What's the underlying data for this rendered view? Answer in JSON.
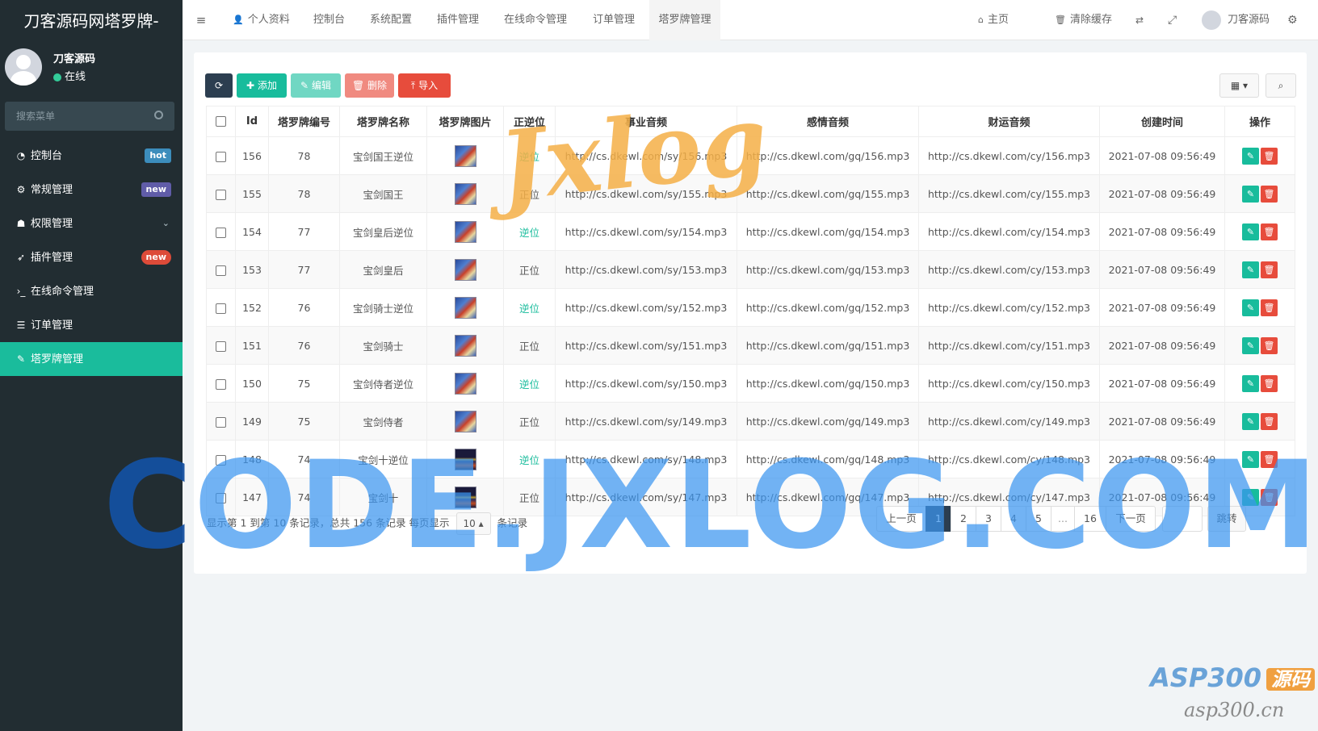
{
  "app": {
    "title": "刀客源码网塔罗牌-"
  },
  "user": {
    "name": "刀客源码",
    "status": "在线"
  },
  "search": {
    "placeholder": "搜索菜单"
  },
  "sidebar": {
    "items": [
      {
        "label": "控制台",
        "icon": "dashboard-icon",
        "badge": "hot"
      },
      {
        "label": "常规管理",
        "icon": "cogs-icon",
        "badge": "new"
      },
      {
        "label": "权限管理",
        "icon": "group-icon",
        "chevron": "chevron-down-icon"
      },
      {
        "label": "插件管理",
        "icon": "rocket-icon",
        "badge": "new"
      },
      {
        "label": "在线命令管理",
        "icon": "terminal-icon"
      },
      {
        "label": "订单管理",
        "icon": "list-icon"
      },
      {
        "label": "塔罗牌管理",
        "icon": "paint-icon",
        "active": true
      }
    ]
  },
  "topnav": {
    "tabs": [
      "个人资料",
      "控制台",
      "系统配置",
      "插件管理",
      "在线命令管理",
      "订单管理",
      "塔罗牌管理"
    ],
    "home": "主页",
    "clear_cache": "清除缓存",
    "username": "刀客源码"
  },
  "toolbar": {
    "add": "添加",
    "edit": "编辑",
    "delete": "删除",
    "import": "导入"
  },
  "table": {
    "headers": [
      "Id",
      "塔罗牌编号",
      "塔罗牌名称",
      "塔罗牌图片",
      "正逆位",
      "事业音频",
      "感情音频",
      "财运音频",
      "创建时间",
      "操作"
    ],
    "rows": [
      {
        "id": "156",
        "num": "78",
        "name": "宝剑国王逆位",
        "pos": "逆位",
        "sy": "http://cs.dkewl.com/sy/156.mp3",
        "gq": "http://cs.dkewl.com/gq/156.mp3",
        "cy": "http://cs.dkewl.com/cy/156.mp3",
        "time": "2021-07-08 09:56:49"
      },
      {
        "id": "155",
        "num": "78",
        "name": "宝剑国王",
        "pos": "正位",
        "sy": "http://cs.dkewl.com/sy/155.mp3",
        "gq": "http://cs.dkewl.com/gq/155.mp3",
        "cy": "http://cs.dkewl.com/cy/155.mp3",
        "time": "2021-07-08 09:56:49"
      },
      {
        "id": "154",
        "num": "77",
        "name": "宝剑皇后逆位",
        "pos": "逆位",
        "sy": "http://cs.dkewl.com/sy/154.mp3",
        "gq": "http://cs.dkewl.com/gq/154.mp3",
        "cy": "http://cs.dkewl.com/cy/154.mp3",
        "time": "2021-07-08 09:56:49"
      },
      {
        "id": "153",
        "num": "77",
        "name": "宝剑皇后",
        "pos": "正位",
        "sy": "http://cs.dkewl.com/sy/153.mp3",
        "gq": "http://cs.dkewl.com/gq/153.mp3",
        "cy": "http://cs.dkewl.com/cy/153.mp3",
        "time": "2021-07-08 09:56:49"
      },
      {
        "id": "152",
        "num": "76",
        "name": "宝剑骑士逆位",
        "pos": "逆位",
        "sy": "http://cs.dkewl.com/sy/152.mp3",
        "gq": "http://cs.dkewl.com/gq/152.mp3",
        "cy": "http://cs.dkewl.com/cy/152.mp3",
        "time": "2021-07-08 09:56:49"
      },
      {
        "id": "151",
        "num": "76",
        "name": "宝剑骑士",
        "pos": "正位",
        "sy": "http://cs.dkewl.com/sy/151.mp3",
        "gq": "http://cs.dkewl.com/gq/151.mp3",
        "cy": "http://cs.dkewl.com/cy/151.mp3",
        "time": "2021-07-08 09:56:49"
      },
      {
        "id": "150",
        "num": "75",
        "name": "宝剑侍者逆位",
        "pos": "逆位",
        "sy": "http://cs.dkewl.com/sy/150.mp3",
        "gq": "http://cs.dkewl.com/gq/150.mp3",
        "cy": "http://cs.dkewl.com/cy/150.mp3",
        "time": "2021-07-08 09:56:49"
      },
      {
        "id": "149",
        "num": "75",
        "name": "宝剑侍者",
        "pos": "正位",
        "sy": "http://cs.dkewl.com/sy/149.mp3",
        "gq": "http://cs.dkewl.com/gq/149.mp3",
        "cy": "http://cs.dkewl.com/cy/149.mp3",
        "time": "2021-07-08 09:56:49"
      },
      {
        "id": "148",
        "num": "74",
        "name": "宝剑十逆位",
        "pos": "逆位",
        "sy": "http://cs.dkewl.com/sy/148.mp3",
        "gq": "http://cs.dkewl.com/gq/148.mp3",
        "cy": "http://cs.dkewl.com/cy/148.mp3",
        "time": "2021-07-08 09:56:49"
      },
      {
        "id": "147",
        "num": "74",
        "name": "宝剑十",
        "pos": "正位",
        "sy": "http://cs.dkewl.com/sy/147.mp3",
        "gq": "http://cs.dkewl.com/gq/147.mp3",
        "cy": "http://cs.dkewl.com/cy/147.mp3",
        "time": "2021-07-08 09:56:49"
      }
    ]
  },
  "pagination": {
    "info_prefix": "显示第 1 到第 10 条记录，总共 156 条记录 每页显示",
    "page_size": "10",
    "info_suffix": "条记录",
    "prev": "上一页",
    "pages": [
      "1",
      "2",
      "3",
      "4",
      "5",
      "...",
      "16"
    ],
    "current": "1",
    "next": "下一页",
    "jump": "跳转"
  },
  "watermarks": {
    "code": "CODE.JXLOG.COM",
    "jxlog": "Jxlog",
    "asp": "ASP300",
    "asp_badge": "源码",
    "asp_domain": "asp300.cn"
  },
  "colors": {
    "sidebar_bg": "#222d32",
    "active": "#1abc9c",
    "primary": "#2c3e50",
    "success": "#18bc9c",
    "danger": "#e74c3c"
  }
}
